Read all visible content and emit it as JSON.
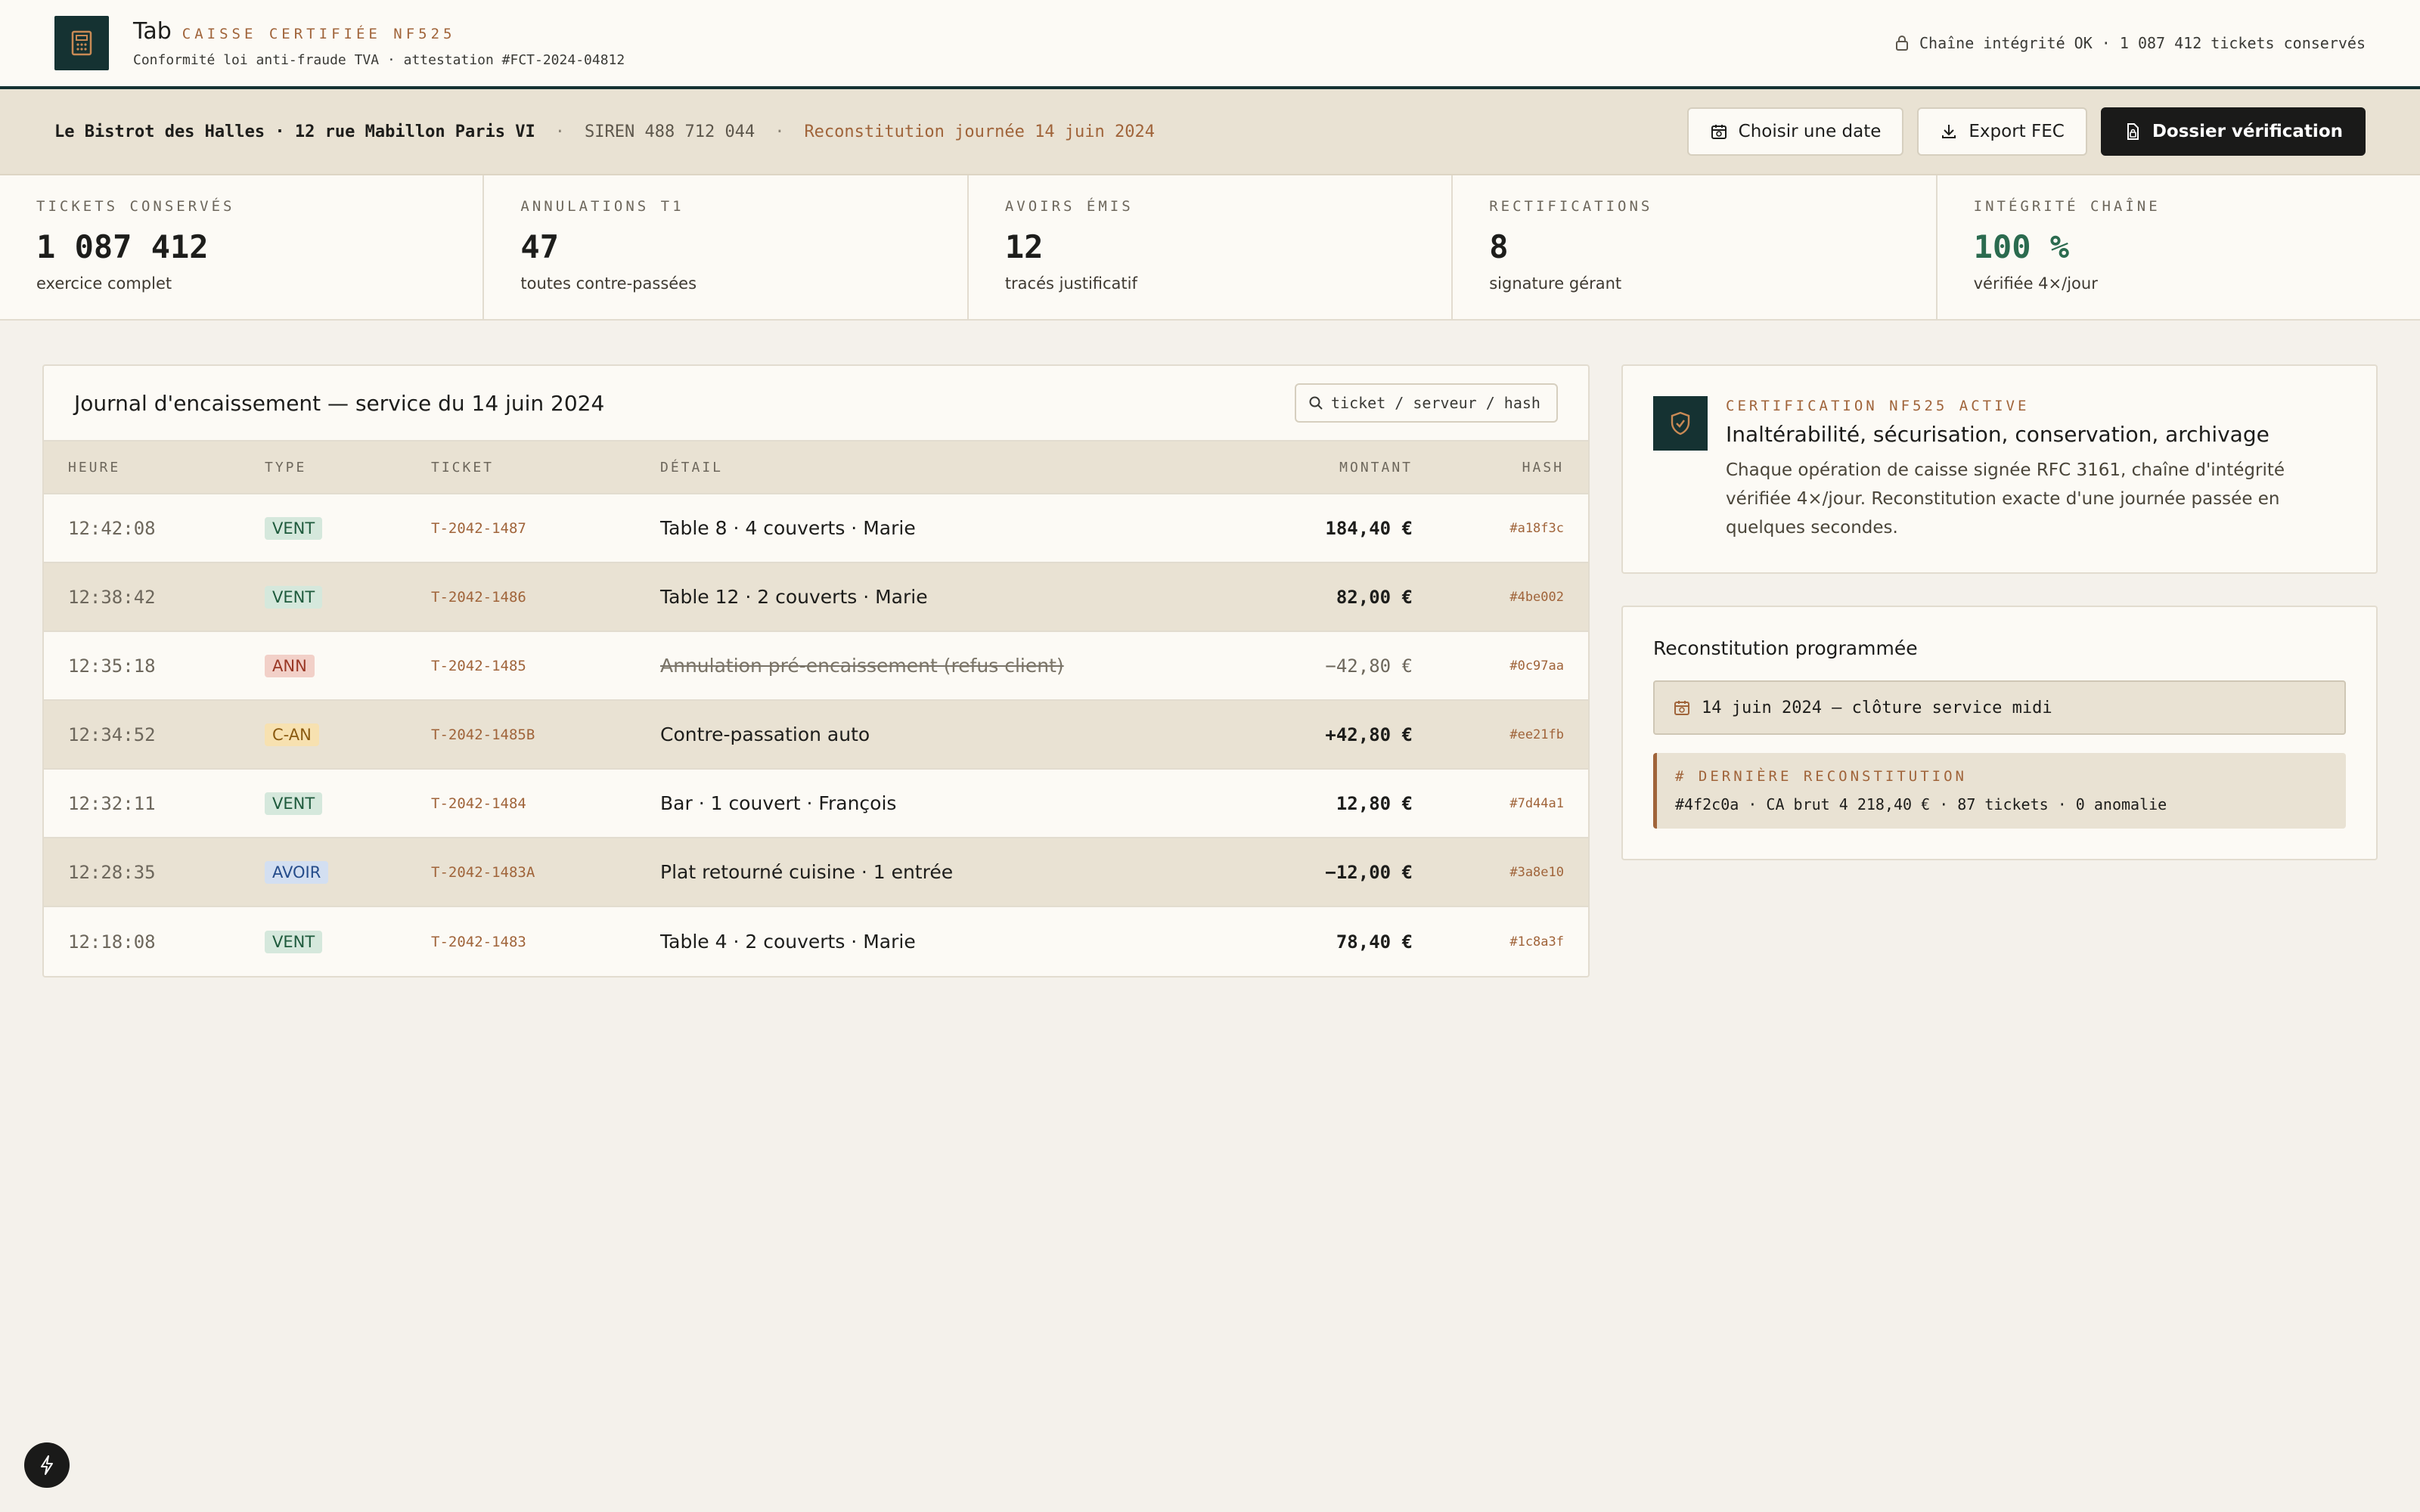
{
  "header": {
    "brand": "Tab",
    "tag": "CAISSE CERTIFIÉE NF525",
    "subtitle": "Conformité loi anti-fraude TVA · attestation #FCT-2024-04812",
    "integrity": "Chaîne intégrité OK · 1 087 412 tickets conservés"
  },
  "subbar": {
    "restaurant": "Le Bistrot des Halles · 12 rue Mabillon Paris VI",
    "separator": "·",
    "siren": "SIREN 488 712 044",
    "reconstitution": "Reconstitution journée 14 juin 2024",
    "buttons": {
      "choose_date": "Choisir une date",
      "export": "Export FEC",
      "dossier": "Dossier vérification"
    }
  },
  "kpis": [
    {
      "label": "TICKETS CONSERVÉS",
      "value": "1 087 412",
      "sub": "exercice complet"
    },
    {
      "label": "ANNULATIONS T1",
      "value": "47",
      "sub": "toutes contre-passées"
    },
    {
      "label": "AVOIRS ÉMIS",
      "value": "12",
      "sub": "tracés justificatif"
    },
    {
      "label": "RECTIFICATIONS",
      "value": "8",
      "sub": "signature gérant"
    },
    {
      "label": "INTÉGRITÉ CHAÎNE",
      "value": "100 %",
      "sub": "vérifiée 4×/jour"
    }
  ],
  "journal": {
    "title": "Journal d'encaissement — service du 14 juin 2024",
    "search_placeholder": "ticket / serveur / hash",
    "columns": {
      "time": "HEURE",
      "type": "TYPE",
      "ticket": "TICKET",
      "detail": "DÉTAIL",
      "amount": "MONTANT",
      "hash": "HASH"
    },
    "rows": [
      {
        "time": "12:42:08",
        "type": "VENT",
        "ticket": "T-2042-1487",
        "detail": "Table 8 · 4 couverts · Marie",
        "amount": "184,40 €",
        "hash": "#a18f3c"
      },
      {
        "time": "12:38:42",
        "type": "VENT",
        "ticket": "T-2042-1486",
        "detail": "Table 12 · 2 couverts · Marie",
        "amount": "82,00 €",
        "hash": "#4be002"
      },
      {
        "time": "12:35:18",
        "type": "ANN",
        "ticket": "T-2042-1485",
        "detail": "Annulation pré-encaissement (refus client)",
        "amount": "−42,80 €",
        "hash": "#0c97aa"
      },
      {
        "time": "12:34:52",
        "type": "C-AN",
        "ticket": "T-2042-1485B",
        "detail": "Contre-passation auto",
        "amount": "+42,80 €",
        "hash": "#ee21fb"
      },
      {
        "time": "12:32:11",
        "type": "VENT",
        "ticket": "T-2042-1484",
        "detail": "Bar · 1 couvert · François",
        "amount": "12,80 €",
        "hash": "#7d44a1"
      },
      {
        "time": "12:28:35",
        "type": "AVOIR",
        "ticket": "T-2042-1483A",
        "detail": "Plat retourné cuisine · 1 entrée",
        "amount": "−12,00 €",
        "hash": "#3a8e10"
      },
      {
        "time": "12:18:08",
        "type": "VENT",
        "ticket": "T-2042-1483",
        "detail": "Table 4 · 2 couverts · Marie",
        "amount": "78,40 €",
        "hash": "#1c8a3f"
      }
    ]
  },
  "certification": {
    "tag": "CERTIFICATION NF525 ACTIVE",
    "title": "Inaltérabilité, sécurisation, conservation, archivage",
    "text": "Chaque opération de caisse signée RFC 3161, chaîne d'intégrité vérifiée 4×/jour. Reconstitution exacte d'une journée passée en quelques secondes."
  },
  "reconstitution": {
    "title": "Reconstitution programmée",
    "date": "14 juin 2024 — clôture service midi",
    "last_tag": "# DERNIÈRE RECONSTITUTION",
    "last_value": "#4f2c0a · CA brut 4 218,40 € · 87 tickets · 0 anomalie"
  },
  "colors": {
    "accent": "#a0643a",
    "dark": "#153232",
    "green": "#2b6b4f"
  }
}
